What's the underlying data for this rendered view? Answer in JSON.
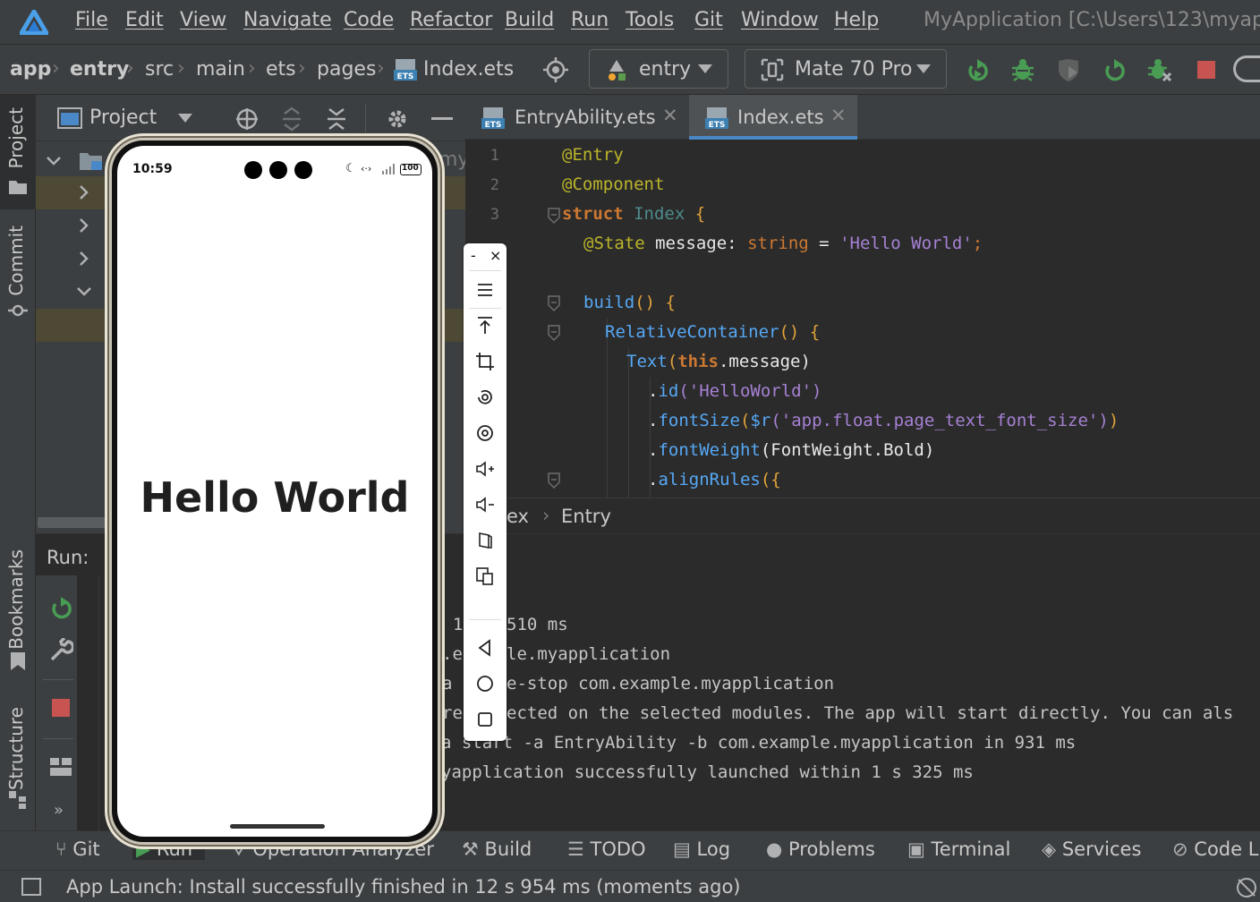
{
  "menu": {
    "items": [
      "File",
      "Edit",
      "View",
      "Navigate",
      "Code",
      "Refactor",
      "Build",
      "Run",
      "Tools",
      "Git",
      "Window",
      "Help"
    ],
    "window_title": "MyApplication [C:\\Users\\123\\myapp\\"
  },
  "nav": {
    "breadcrumb": [
      "app",
      "entry",
      "src",
      "main",
      "ets",
      "pages",
      "Index.ets"
    ],
    "run_config": "entry",
    "device": "Mate 70 Pro"
  },
  "left_strip": {
    "project": "Project",
    "commit": "Commit",
    "bookmarks": "Bookmarks",
    "structure": "Structure"
  },
  "project_panel": {
    "title": "Project",
    "partial_text": "my"
  },
  "editor": {
    "tabs": [
      {
        "label": "EntryAbility.ets",
        "icon": "ets-file-icon"
      },
      {
        "label": "Index.ets",
        "icon": "ets-file-icon"
      }
    ],
    "line_numbers": [
      "1",
      "2",
      "3"
    ],
    "code": {
      "l1": "@Entry",
      "l2": "@Component",
      "l3_kw": "struct",
      "l3_name": "Index",
      "l3_brace": "{",
      "l4_dec": "@State",
      "l4_name": "message",
      "l4_colon": ":",
      "l4_type": "string",
      "l4_eq": "=",
      "l4_val": "'Hello World'",
      "l4_semi": ";",
      "l6_fn": "build",
      "l6_rest": "() {",
      "l7_fn": "RelativeContainer",
      "l7_rest": "() {",
      "l8_fn": "Text",
      "l8_open": "(",
      "l8_this": "this",
      "l8_rest": ".message)",
      "l9_dot": ".",
      "l9_fn": "id",
      "l9_arg": "('HelloWorld')",
      "l10_dot": ".",
      "l10_fn": "fontSize",
      "l10_open": "(",
      "l10_r": "$r",
      "l10_arg": "('app.float.page_text_font_size')",
      "l10_close": ")",
      "l11_dot": ".",
      "l11_fn": "fontWeight",
      "l11_arg": "(FontWeight.Bold)",
      "l12_dot": ".",
      "l12_fn": "alignRules",
      "l12_arg": "({"
    },
    "breadcrumb": [
      "ex",
      "Entry"
    ]
  },
  "run_panel": {
    "title": "Run:",
    "log": [
      {
        "prefix": "1",
        "text": "510 ms"
      },
      {
        "prefix": ".e",
        "text": "le.myapplication"
      },
      {
        "prefix": "a",
        "text": "e-stop com.example.myapplication"
      },
      {
        "prefix": "re",
        "text": "ected on the selected modules. The app will start directly. You can als"
      },
      {
        "prefix": "",
        "text": "a start -a EntryAbility -b com.example.myapplication in 931 ms"
      },
      {
        "prefix": "",
        "text": "yapplication successfully launched within 1 s 325 ms"
      }
    ]
  },
  "bottom_tabs": [
    "Git",
    "Run",
    "Operation Analyzer",
    "Build",
    "TODO",
    "Log",
    "Problems",
    "Terminal",
    "Services",
    "Code L"
  ],
  "status": {
    "message": "App Launch: Install successfully finished in 12 s 954 ms (moments ago)"
  },
  "phone": {
    "time": "10:59",
    "battery": "100",
    "content_text": "Hello World"
  },
  "emulator_toolbar": {
    "minimize": "-",
    "close": "×"
  },
  "colors": {
    "keyword": "#cc7832",
    "annotation": "#bbb529",
    "string": "#6a8759",
    "function": "#56a8f5",
    "type": "#cc7832",
    "accent_green": "#499c54",
    "stop_red": "#c75450"
  }
}
